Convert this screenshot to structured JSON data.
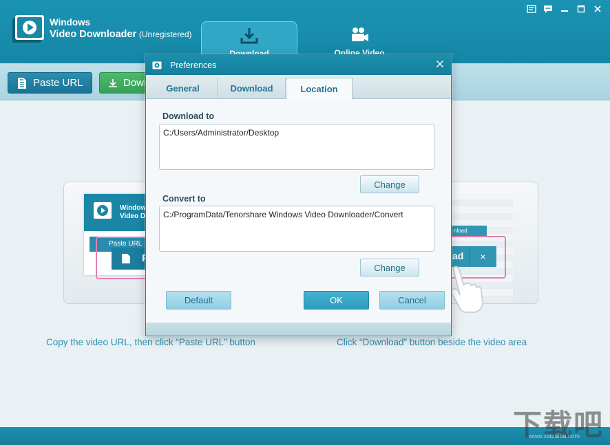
{
  "app": {
    "name_line1": "Windows",
    "name_line2": "Video Downloader",
    "registration": "(Unregistered)"
  },
  "main_tabs": [
    {
      "label": "Download",
      "active": true
    },
    {
      "label": "Online Video",
      "active": false
    }
  ],
  "toolbar": {
    "paste_url_label": "Paste URL",
    "download_label": "Down"
  },
  "guide": {
    "left_caption": "Copy the video URL, then click “Paste URL” button",
    "right_caption": "Click “Download” button beside the video area",
    "mock_app_name1": "Window",
    "mock_app_name2": "Video D",
    "mock_paste_label": "Paste URL",
    "mock_big_label": "P",
    "mock_download_label": "ad",
    "mock_tab_label": "nload",
    "mock_close": "×"
  },
  "dialog": {
    "title": "Preferences",
    "tabs": [
      {
        "label": "General",
        "active": false
      },
      {
        "label": "Download",
        "active": false
      },
      {
        "label": "Location",
        "active": true
      }
    ],
    "download_to_label": "Download to",
    "download_to_path": "C:/Users/Administrator/Desktop",
    "convert_to_label": "Convert to",
    "convert_to_path": "C:/ProgramData/Tenorshare Windows Video Downloader/Convert",
    "change_label": "Change",
    "default_label": "Default",
    "ok_label": "OK",
    "cancel_label": "Cancel"
  },
  "watermark": {
    "main": "下载吧",
    "sub": "www.xiazaiba.com"
  },
  "icons": {
    "window_controls": [
      "feedback-icon",
      "chat-icon",
      "minimize-icon",
      "maximize-icon",
      "close-icon"
    ]
  },
  "colors": {
    "title_bar": "#1687a6",
    "accent": "#2a8fb4",
    "download_green": "#37a257",
    "highlight_pink": "#e37fb0"
  }
}
